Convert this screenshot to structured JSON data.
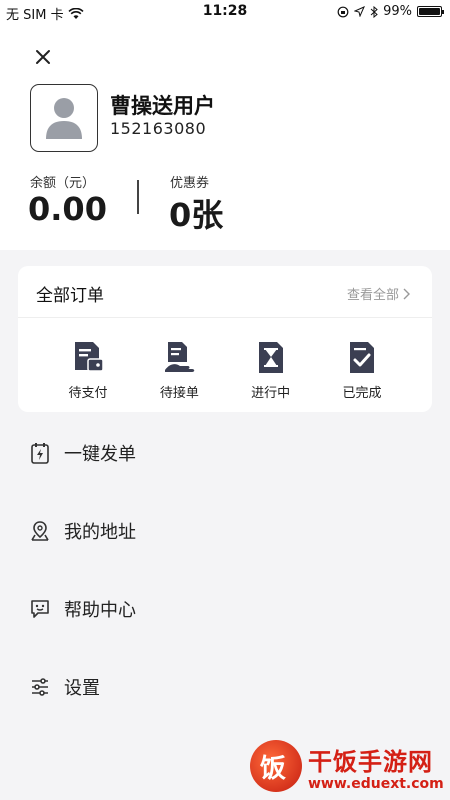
{
  "status": {
    "carrier": "无 SIM 卡",
    "time": "11:28",
    "battery": "99%"
  },
  "user": {
    "name": "曹操送用户",
    "id": "152163080"
  },
  "stats": {
    "balance_label": "余额（元）",
    "balance_value": "0.00",
    "coupon_label": "优惠券",
    "coupon_value": "0张"
  },
  "orders": {
    "title": "全部订单",
    "view_all": "查看全部",
    "items": [
      {
        "label": "待支付",
        "icon": "wallet-doc-icon"
      },
      {
        "label": "待接单",
        "icon": "hand-doc-icon"
      },
      {
        "label": "进行中",
        "icon": "hourglass-doc-icon"
      },
      {
        "label": "已完成",
        "icon": "check-doc-icon"
      }
    ]
  },
  "menu": [
    {
      "label": "一键发单",
      "icon": "lightning-clipboard-icon"
    },
    {
      "label": "我的地址",
      "icon": "location-pin-icon"
    },
    {
      "label": "帮助中心",
      "icon": "chat-help-icon"
    },
    {
      "label": "设置",
      "icon": "sliders-settings-icon"
    }
  ],
  "watermark": {
    "title": "干饭手游网",
    "url": "www.eduext.com"
  },
  "colors": {
    "accent_icon": "#3b3f52",
    "watermark_red": "#d42015"
  }
}
